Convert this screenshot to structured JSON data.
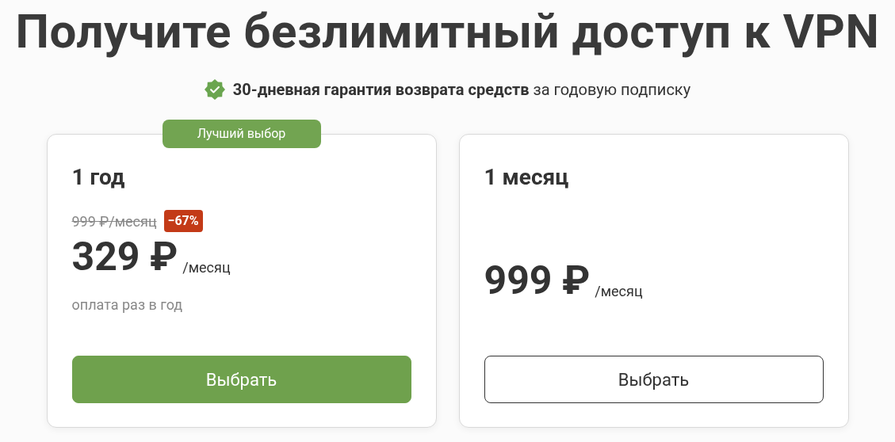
{
  "title": "Получите безлимитный доступ к VPN",
  "guarantee": {
    "text": "**30-дневная гарантия возврата средств** за годовую подписку"
  },
  "plans": [
    {
      "badge": "Лучший выбор",
      "name": "1 год",
      "old_price": "999 ₽/месяц",
      "discount": "−67%",
      "price": "329 ₽",
      "unit": "/месяц",
      "note": "оплата раз в год",
      "button": {
        "label": "Выбрать",
        "kind": "primary"
      }
    },
    {
      "name": "1 месяц",
      "price": "999 ₽",
      "unit": "/месяц",
      "button": {
        "label": "Выбрать",
        "kind": "outline"
      }
    }
  ]
}
